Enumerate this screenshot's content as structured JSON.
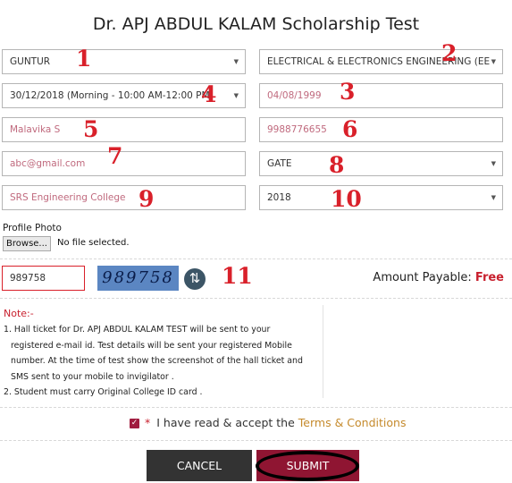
{
  "title": "Dr. APJ ABDUL KALAM Scholarship Test",
  "fields": {
    "district": "GUNTUR",
    "branch": "ELECTRICAL & ELECTRONICS ENGINEERING (EEE",
    "slot": "30/12/2018 (Morning - 10:00 AM-12:00 PM)",
    "dob_placeholder": "04/08/1999",
    "name": "Malavika S",
    "mobile": "9988776655",
    "email": "abc@gmail.com",
    "exam": "GATE",
    "college": "SRS Engineering College",
    "year": "2018"
  },
  "markers": [
    "1",
    "2",
    "3",
    "4",
    "5",
    "6",
    "7",
    "8",
    "9",
    "10",
    "11"
  ],
  "photo": {
    "label": "Profile Photo",
    "browse": "Browse...",
    "status": "No file selected."
  },
  "captcha": {
    "value": "989758",
    "image_text": "989758"
  },
  "amount": {
    "label": "Amount Payable:",
    "value": "Free"
  },
  "note": {
    "title": "Note:-",
    "items": [
      "1. Hall ticket for Dr. APJ ABDUL KALAM TEST will be sent to your registered e-mail id. Test details will be sent your registered Mobile number. At the time of test show the screenshot of the hall ticket and SMS sent to your mobile to invigilator .",
      "2. Student must carry Original College ID card ."
    ]
  },
  "terms": {
    "star": "*",
    "text": "I have read & accept the",
    "link": "Terms & Conditions"
  },
  "buttons": {
    "cancel": "CANCEL",
    "submit": "SUBMIT"
  },
  "colors": {
    "accent": "#8f1532",
    "marker": "#d9202a",
    "cancel": "#333333",
    "link": "#c58a2c"
  }
}
